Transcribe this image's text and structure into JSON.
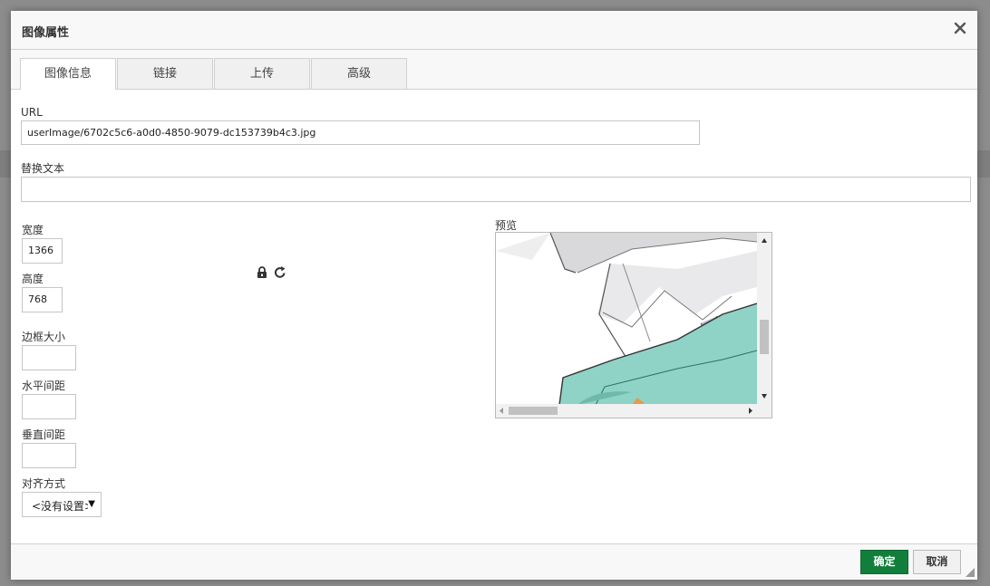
{
  "dialog": {
    "title": "图像属性",
    "tabs": [
      "图像信息",
      "链接",
      "上传",
      "高级"
    ],
    "active_tab": 0
  },
  "form": {
    "url_label": "URL",
    "url_value": "userImage/6702c5c6-a0d0-4850-9079-dc153739b4c3.jpg",
    "alt_label": "替换文本",
    "alt_value": "",
    "width_label": "宽度",
    "width_value": "1366",
    "height_label": "高度",
    "height_value": "768",
    "border_label": "边框大小",
    "border_value": "",
    "hspace_label": "水平间距",
    "hspace_value": "",
    "vspace_label": "垂直间距",
    "vspace_value": "",
    "align_label": "对齐方式",
    "align_value": "<没有设置>",
    "preview_label": "预览"
  },
  "icons": {
    "lock": "lock-icon",
    "reset": "reset-size-icon",
    "close": "close-icon"
  },
  "footer": {
    "ok_label": "确定",
    "cancel_label": "取消"
  },
  "colors": {
    "ok_button": "#127e3b",
    "preview_teal": "#8fd3c6"
  }
}
